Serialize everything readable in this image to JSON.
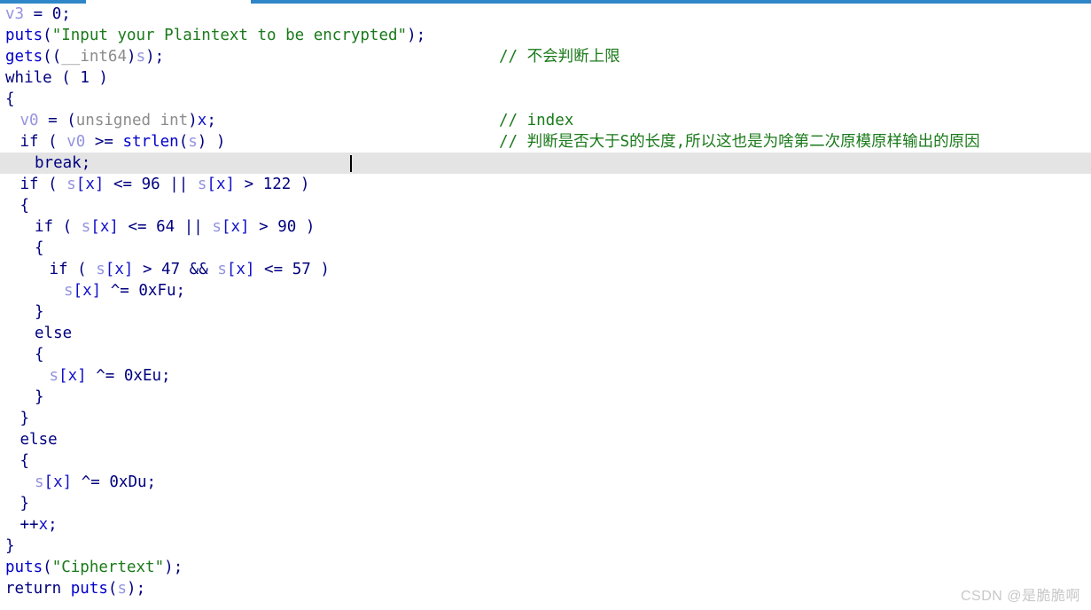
{
  "window": {
    "top_strip_color": "#2e86c8",
    "tab_gap_color": "#ffffff"
  },
  "editor": {
    "background": "#ffffff",
    "highlight_color": "#e4e4e4",
    "caret_color": "#000000",
    "comment_color": "#1a7a1a",
    "keyword_color": "#00007f",
    "function_color": "#0000cd",
    "string_color": "#1a7a1a",
    "variable_color": "#9494e0",
    "type_color": "#8c8c8c",
    "highlighted_line_index": 7,
    "caret_line_index": 7,
    "lines": [
      {
        "indent": 0,
        "code": "v3 = 0;",
        "comment": ""
      },
      {
        "indent": 0,
        "code": "puts(\"Input your Plaintext to be encrypted\");",
        "comment": ""
      },
      {
        "indent": 0,
        "code": "gets((__int64)s);",
        "comment": "// 不会判断上限"
      },
      {
        "indent": 0,
        "code": "while ( 1 )",
        "comment": ""
      },
      {
        "indent": 0,
        "code": "{",
        "comment": ""
      },
      {
        "indent": 1,
        "code": "v0 = (unsigned int)x;",
        "comment": "// index"
      },
      {
        "indent": 1,
        "code": "if ( v0 >= strlen(s) )",
        "comment": "// 判断是否大于S的长度,所以这也是为啥第二次原模原样输出的原因"
      },
      {
        "indent": 2,
        "code": "break;",
        "comment": ""
      },
      {
        "indent": 1,
        "code": "if ( s[x] <= 96 || s[x] > 122 )",
        "comment": ""
      },
      {
        "indent": 1,
        "code": "{",
        "comment": ""
      },
      {
        "indent": 2,
        "code": "if ( s[x] <= 64 || s[x] > 90 )",
        "comment": ""
      },
      {
        "indent": 2,
        "code": "{",
        "comment": ""
      },
      {
        "indent": 3,
        "code": "if ( s[x] > 47 && s[x] <= 57 )",
        "comment": ""
      },
      {
        "indent": 4,
        "code": "s[x] ^= 0xFu;",
        "comment": ""
      },
      {
        "indent": 2,
        "code": "}",
        "comment": ""
      },
      {
        "indent": 2,
        "code": "else",
        "comment": ""
      },
      {
        "indent": 2,
        "code": "{",
        "comment": ""
      },
      {
        "indent": 3,
        "code": "s[x] ^= 0xEu;",
        "comment": ""
      },
      {
        "indent": 2,
        "code": "}",
        "comment": ""
      },
      {
        "indent": 1,
        "code": "}",
        "comment": ""
      },
      {
        "indent": 1,
        "code": "else",
        "comment": ""
      },
      {
        "indent": 1,
        "code": "{",
        "comment": ""
      },
      {
        "indent": 2,
        "code": "s[x] ^= 0xDu;",
        "comment": ""
      },
      {
        "indent": 1,
        "code": "}",
        "comment": ""
      },
      {
        "indent": 1,
        "code": "++x;",
        "comment": ""
      },
      {
        "indent": 0,
        "code": "}",
        "comment": ""
      },
      {
        "indent": 0,
        "code": "puts(\"Ciphertext\");",
        "comment": ""
      },
      {
        "indent": 0,
        "code": "return puts(s);",
        "comment": ""
      }
    ]
  },
  "watermark": {
    "text": "CSDN @是脆脆啊"
  }
}
